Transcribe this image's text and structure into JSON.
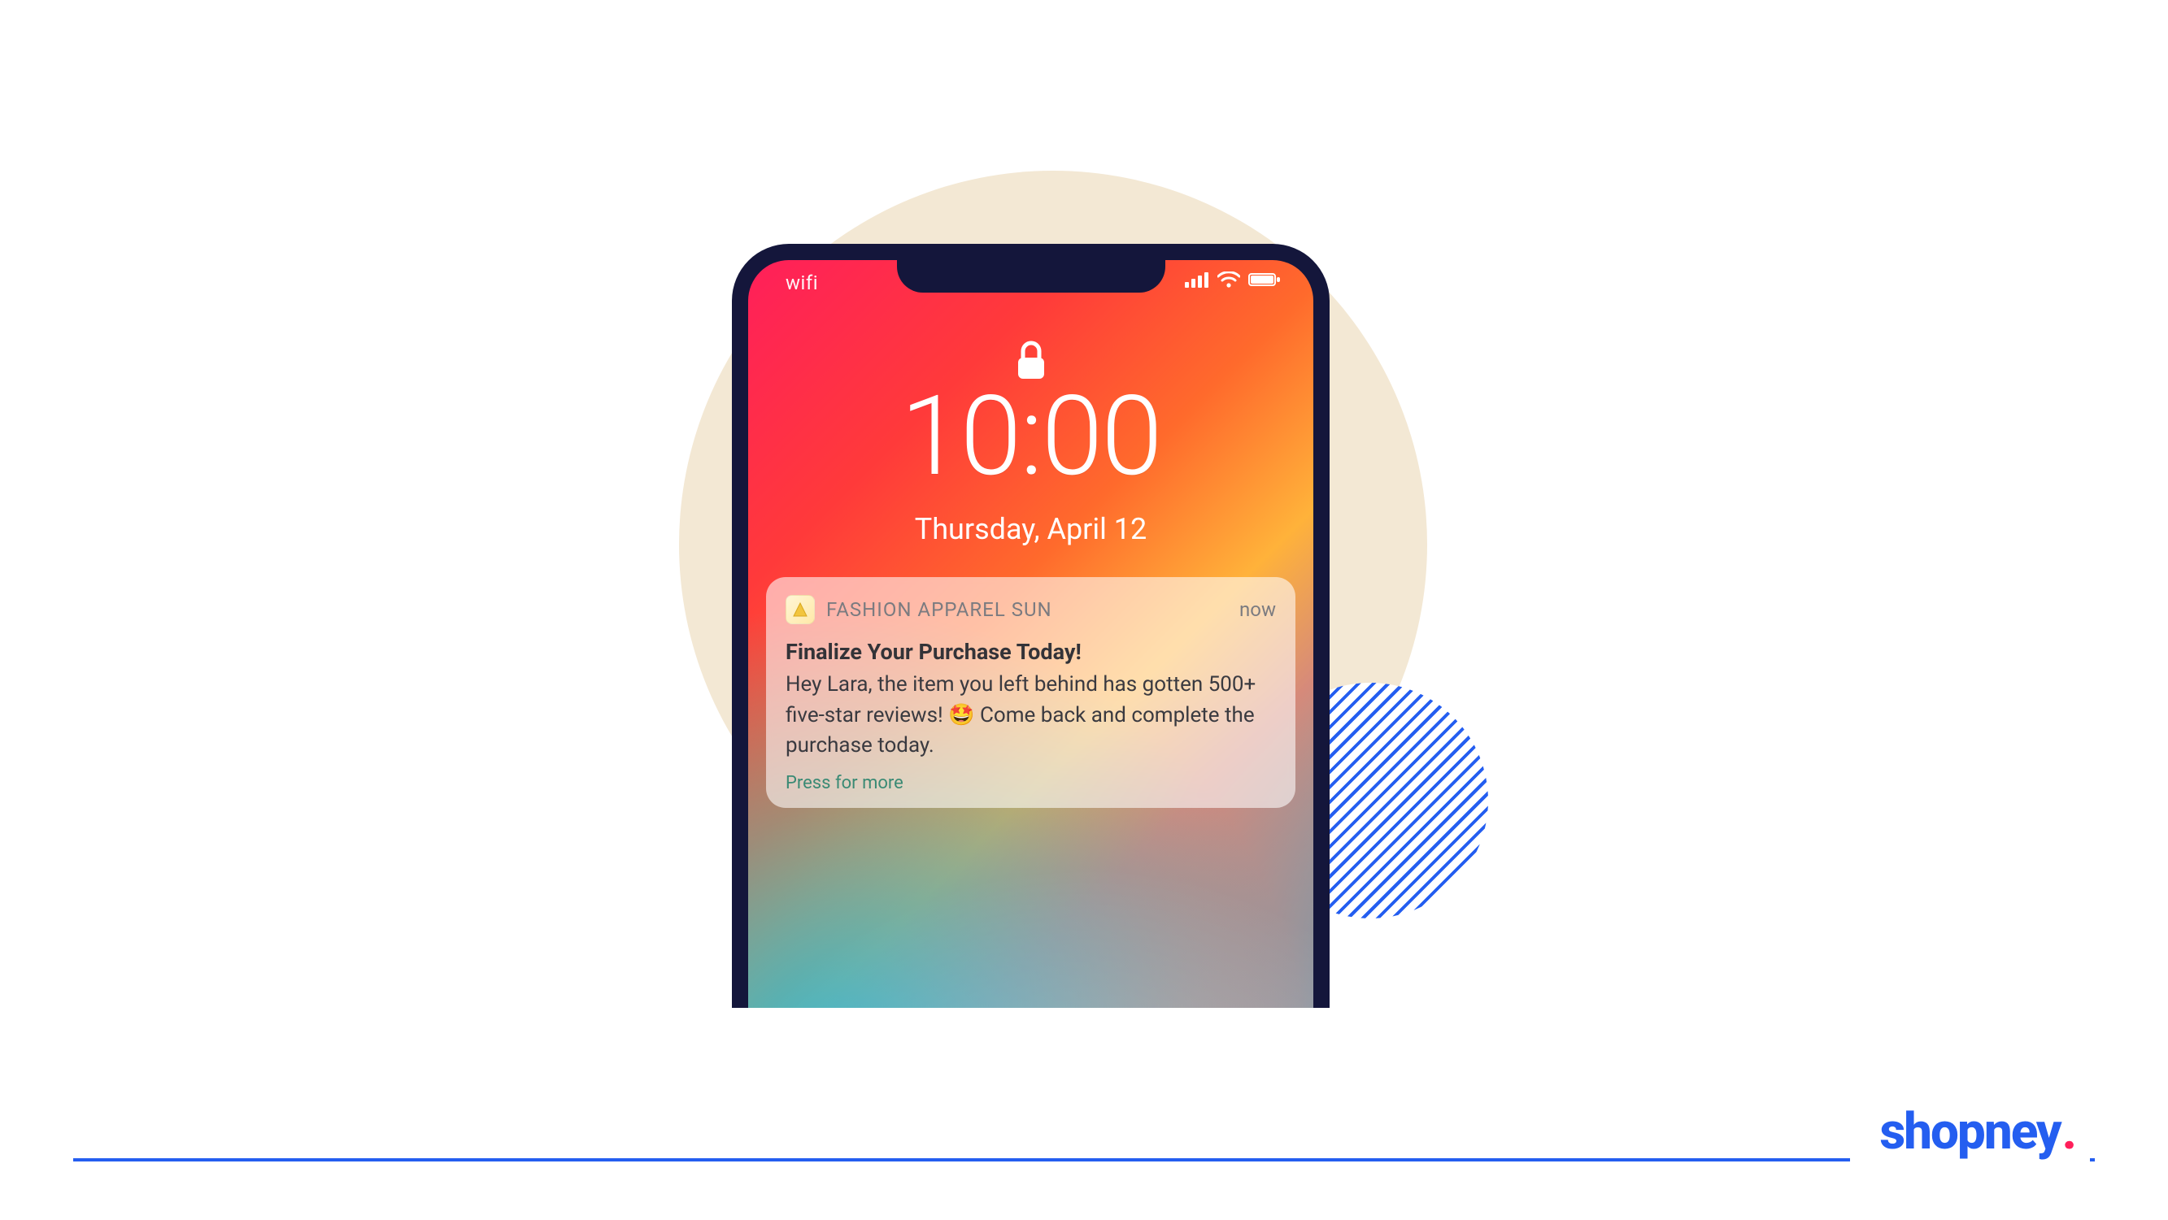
{
  "phone": {
    "status": {
      "wifi_label": "wifi"
    },
    "lockscreen": {
      "time": "10:00",
      "date": "Thursday, April 12"
    },
    "notification": {
      "app_name": "FASHION APPAREL SUN",
      "timestamp": "now",
      "title": "Finalize Your Purchase Today!",
      "body": "Hey Lara, the item you left behind has gotten 500+ five-star reviews! 🤩 Come back and complete the purchase today.",
      "more_label": "Press for more"
    }
  },
  "brand": {
    "name": "shopney",
    "dot": ".",
    "colors": {
      "primary": "#245ef0",
      "accent": "#ff1f5a",
      "beige": "#f3e8d4"
    }
  }
}
